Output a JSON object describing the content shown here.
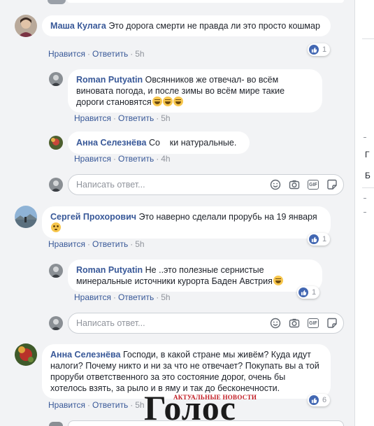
{
  "actions": {
    "like": "Нравится",
    "reply": "Ответить",
    "sep": "·"
  },
  "comments": [
    {
      "author": "Маша Кулага",
      "text": "Это дорога смерти не правда ли это просто кошмар",
      "time": "5h",
      "reactions": "1"
    },
    {
      "author": "Roman Putyatin",
      "text": "Овсянников же отвечал- во всём виновата погода, и после зимы во всём мире такие дороги становятся",
      "emojis": [
        "grinning-squinting-emoji",
        "grinning-squinting-emoji",
        "grinning-squinting-emoji"
      ],
      "time": "5h"
    },
    {
      "author": "Анна Селезнёва",
      "text": "Со    ки натуральные.",
      "time": "4h"
    },
    {
      "author": "Сергей Прохорович",
      "text": "Это наверно сделали прорубь на 19 января",
      "emojis": [
        "flushed-emoji"
      ],
      "time": "5h",
      "reactions": "1"
    },
    {
      "author": "Roman Putyatin",
      "text": "Не ..это полезные сернистые минеральные источники курорта Баден Австрия",
      "emojis": [
        "grinning-squinting-emoji"
      ],
      "time": "5h",
      "reactions": "1"
    },
    {
      "author": "Анна Селезнёва",
      "text": "Господи, в какой стране мы живём? Куда идут налоги? Почему никто и ни за что не отвечает? Покупать вы а той проруби ответственного за это состояние дорог, очень бы хотелось взять, за рыло и в яму и так до бесконечности.",
      "time": "5h",
      "reactions": "6"
    }
  ],
  "reply_input": {
    "placeholder": "Написать ответ..."
  },
  "input_icons": [
    "emoji-icon",
    "camera-icon",
    "gif-icon",
    "sticker-icon"
  ],
  "watermark": {
    "big": "Голос",
    "small": "АКТУАЛЬНЫЕ НОВОСТИ"
  },
  "right_column_chars": [
    "Г",
    "Б"
  ],
  "colors": {
    "link": "#385898",
    "like": "#4267b2",
    "muted": "#90949c",
    "bg": "#f2f3f5"
  }
}
